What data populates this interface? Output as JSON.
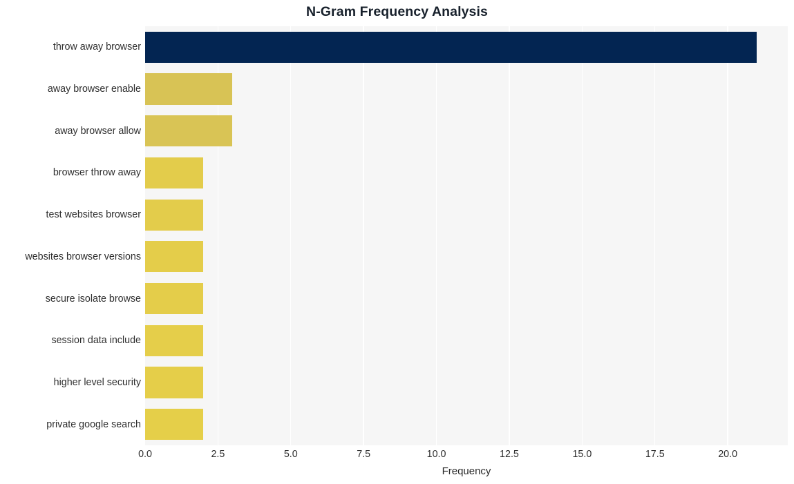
{
  "chart_data": {
    "type": "bar",
    "orientation": "horizontal",
    "title": "N-Gram Frequency Analysis",
    "xlabel": "Frequency",
    "ylabel": "",
    "categories": [
      "throw away browser",
      "away browser enable",
      "away browser allow",
      "browser throw away",
      "test websites browser",
      "websites browser versions",
      "secure isolate browse",
      "session data include",
      "higher level security",
      "private google search"
    ],
    "values": [
      21,
      3,
      3,
      2,
      2,
      2,
      2,
      2,
      2,
      2
    ],
    "bar_colors": [
      "#032552",
      "#d8c355",
      "#d9c455",
      "#e3cc4b",
      "#e3cc4b",
      "#e4cd4a",
      "#e4cd4a",
      "#e5ce4a",
      "#e5ce49",
      "#e5cf49"
    ],
    "xlim": [
      0,
      22.06
    ],
    "ylim": [
      0,
      10
    ],
    "xticks": [
      0,
      2.5,
      5,
      7.5,
      10,
      12.5,
      15,
      17.5,
      20
    ],
    "xtick_labels": [
      "0.0",
      "2.5",
      "5.0",
      "7.5",
      "10.0",
      "12.5",
      "15.0",
      "17.5",
      "20.0"
    ],
    "grid": "vertical-only",
    "legend": "none",
    "plot_background": "#f6f6f6",
    "figure_background": "#ffffff",
    "gridline_color": "#ffffff"
  }
}
